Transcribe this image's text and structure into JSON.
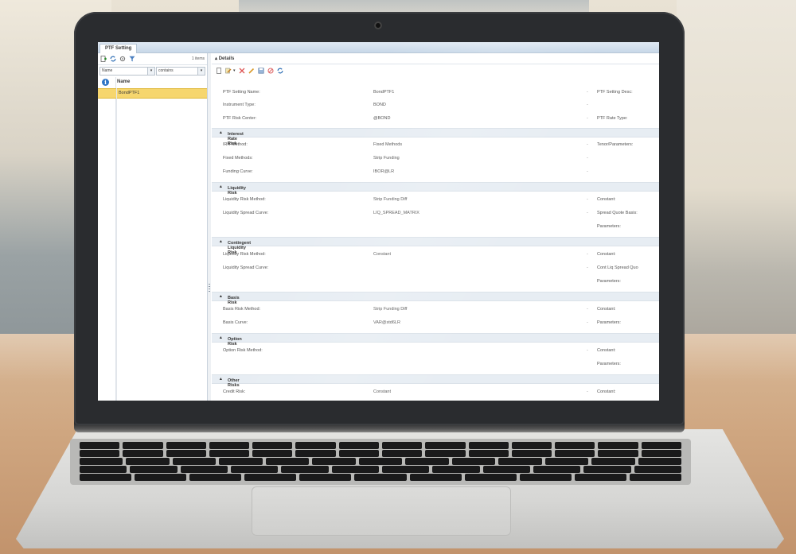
{
  "app": {
    "tab_title": "PTF Setting",
    "items_count": "1 items"
  },
  "colors": {
    "selection": "#f6d66e",
    "info_icon": "#2f75c5",
    "section_bg": "#e7edf3"
  },
  "left_panel": {
    "toolbar_icons": [
      "add-icon",
      "refresh-icon",
      "settings-icon",
      "filter-icon"
    ],
    "filter_field": "Name",
    "filter_operator": "contains",
    "column_header": "Name",
    "rows": [
      "BondPTF1"
    ]
  },
  "details": {
    "title": "Details",
    "toolbar_icons": [
      "new-icon",
      "edit-icon",
      "delete-icon",
      "pencil-icon",
      "save-icon",
      "cancel-icon",
      "refresh-icon"
    ],
    "general": [
      {
        "label": "PTF Setting Name:",
        "value": "BondPTF1",
        "right": "PTF Setting Desc:"
      },
      {
        "label": "Instrument Type:",
        "value": "BOND",
        "right": ""
      },
      {
        "label": "PTF Risk Center:",
        "value": "@BOND",
        "right": "PTF Rate Type:"
      }
    ],
    "sections": [
      {
        "title": "Interest Rate Risk",
        "rows": [
          {
            "label": "IRR Method:",
            "value": "Fixed Methods",
            "right": "Tenor/Parameters:"
          },
          {
            "label": "Fixed Methods:",
            "value": "Strip Funding",
            "right": ""
          },
          {
            "label": "Funding Curve:",
            "value": "IBOR@LR",
            "right": ""
          }
        ]
      },
      {
        "title": "Liquidity Risk",
        "rows": [
          {
            "label": "Liquidity Risk Method:",
            "value": "Strip Funding Diff",
            "right": "Constant:"
          },
          {
            "label": "Liquidity Spread Curve:",
            "value": "LIQ_SPREAD_MATRIX",
            "right": "Spread Quote Basis:"
          },
          {
            "label": "",
            "value": "",
            "right": "Parameters:"
          }
        ]
      },
      {
        "title": "Contingent Liquidity Risk",
        "rows": [
          {
            "label": "Liquidity Risk Method:",
            "value": "Constant",
            "right": "Constant:"
          },
          {
            "label": "Liquidity Spread Curve:",
            "value": "",
            "right": "Cont Liq Spread Quo"
          },
          {
            "label": "",
            "value": "",
            "right": "Parameters:"
          }
        ]
      },
      {
        "title": "Basis Risk",
        "rows": [
          {
            "label": "Basis Risk Method:",
            "value": "Strip Funding Diff",
            "right": "Constant:"
          },
          {
            "label": "Basis Curve:",
            "value": "VAR@std6LR",
            "right": "Parameters:"
          }
        ]
      },
      {
        "title": "Option Risk",
        "rows": [
          {
            "label": "Option Risk Method:",
            "value": "",
            "right": "Constant:"
          },
          {
            "label": "",
            "value": "",
            "right": "Parameters:"
          }
        ]
      },
      {
        "title": "Other Risks",
        "rows": [
          {
            "label": "Credit Risk:",
            "value": "Constant",
            "right": "Constant:"
          }
        ]
      }
    ]
  }
}
